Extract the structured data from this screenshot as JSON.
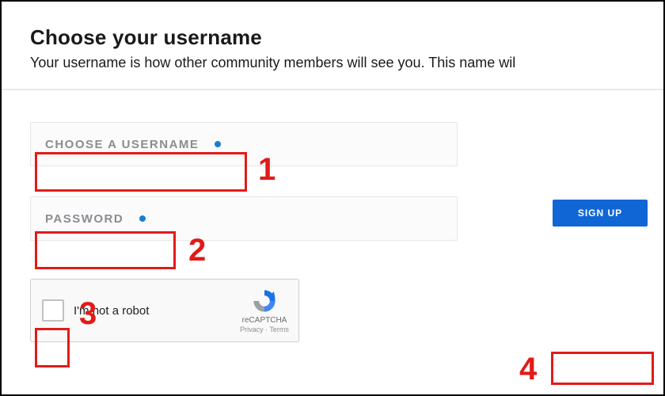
{
  "header": {
    "title": "Choose your username",
    "subtitle": "Your username is how other community members will see you. This name wil"
  },
  "form": {
    "username_label": "CHOOSE A USERNAME",
    "password_label": "PASSWORD"
  },
  "recaptcha": {
    "text": "I'm not a robot",
    "brand": "reCAPTCHA",
    "legal": "Privacy · Terms"
  },
  "signup": {
    "label": "SIGN UP"
  },
  "annotations": {
    "n1": "1",
    "n2": "2",
    "n3": "3",
    "n4": "4"
  },
  "colors": {
    "accent": "#1166d6",
    "annotation": "#e11b19"
  }
}
